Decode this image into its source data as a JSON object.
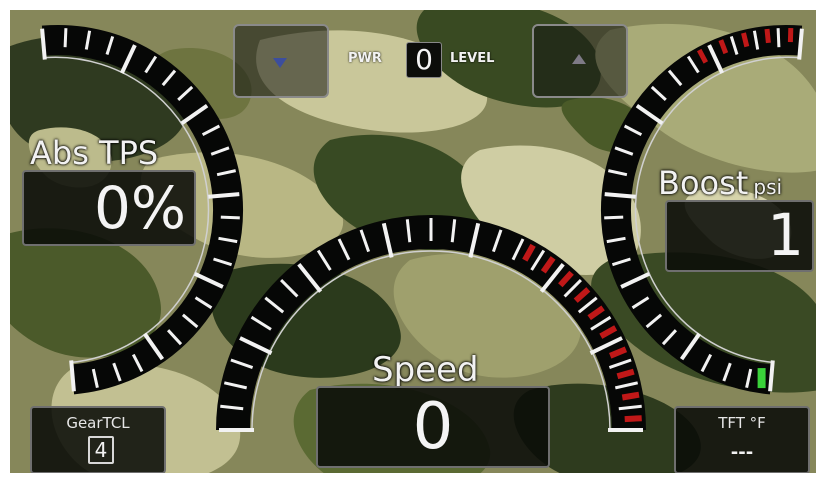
{
  "power_level": {
    "prefix_label": "PWR",
    "value": "0",
    "suffix_label": "LEVEL"
  },
  "gauges": {
    "throttle": {
      "label": "Abs TPS",
      "value": "0%",
      "fill_fraction": 0
    },
    "boost": {
      "label": "Boost",
      "unit": "psi",
      "value": "1",
      "fill_fraction": 0.02
    },
    "speed": {
      "label": "Speed",
      "value": "0",
      "fill_fraction": 0
    }
  },
  "corner_readouts": {
    "gear": {
      "label": "GearTCL",
      "value": "4"
    },
    "temperature": {
      "label": "TFT °F",
      "value": "---"
    }
  },
  "colors": {
    "redline": "#c01818",
    "indicator_green": "#3ad23a",
    "arrow_blue": "#3c4e9e",
    "arrow_grey": "#7e7a86"
  },
  "icons": {
    "decrease": "triangle-down-icon",
    "increase": "triangle-up-icon"
  }
}
